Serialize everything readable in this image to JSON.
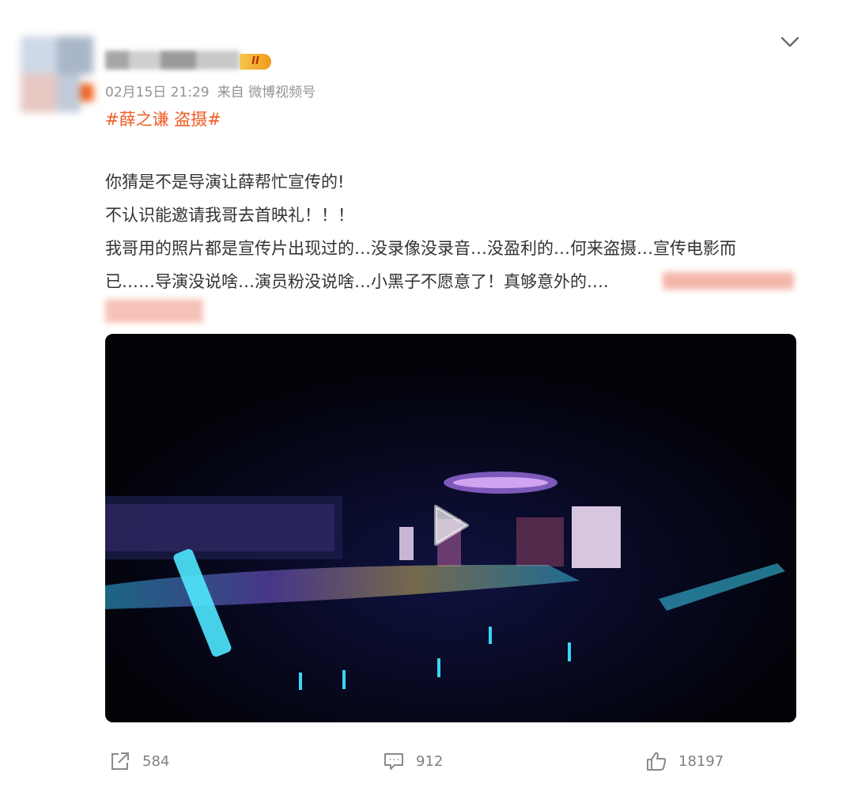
{
  "post": {
    "vip_badge": "II",
    "date": "02月15日 21:29",
    "source": "来自 微博视频号",
    "hashtag": "#薛之谦 盗摄#",
    "body_lines": [
      "你猜是不是导演让薛帮忙宣传的!",
      "不认识能邀请我哥去首映礼！！！",
      "我哥用的照片都是宣传片出现过的…没录像没录音…没盈利的…何来盗摄…宣传电影而",
      "已……导演没说啥…演员粉没说啥…小黑子不愿意了！真够意外的…."
    ]
  },
  "actions": {
    "repost_count": "584",
    "comment_count": "912",
    "like_count": "18197"
  },
  "icons": {
    "menu": "chevron-down-icon",
    "play": "play-icon",
    "repost": "share-icon",
    "comment": "comment-icon",
    "like": "thumbs-up-icon"
  },
  "colors": {
    "hashtag": "#f05c25",
    "meta": "#939393",
    "body_text": "#333333",
    "vip_badge": "#f19a1b",
    "count": "#808080"
  }
}
